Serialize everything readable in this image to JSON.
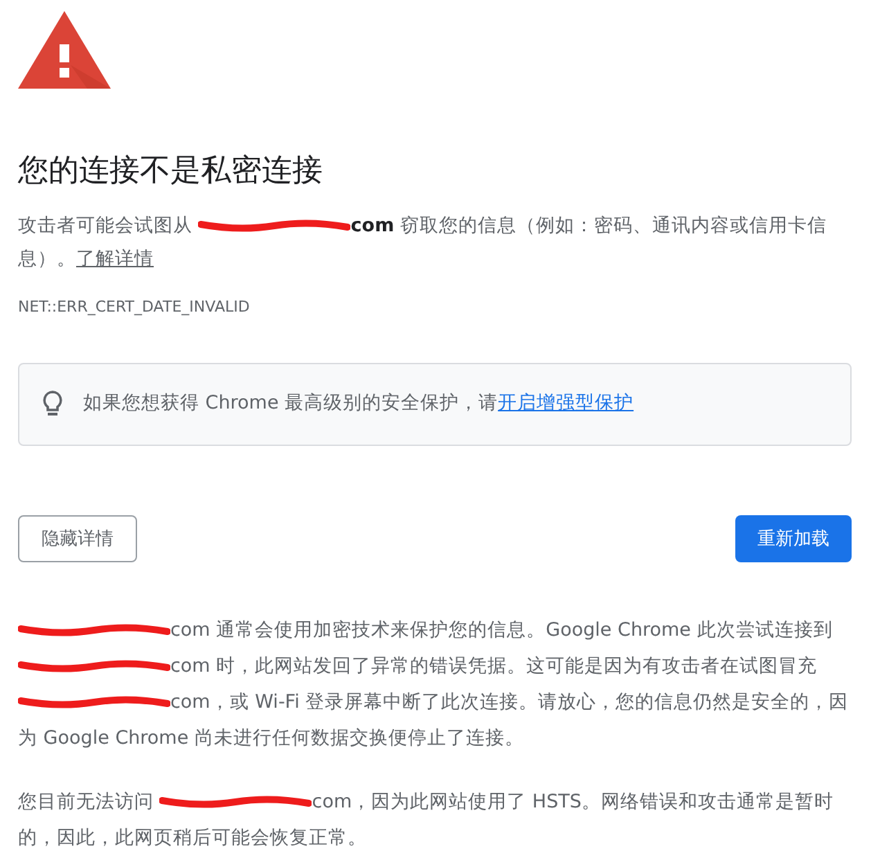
{
  "title": "您的连接不是私密连接",
  "intro": [
    {
      "kind": "text",
      "text": "攻击者可能会试图从 "
    },
    {
      "kind": "redacted",
      "text": "com"
    },
    {
      "kind": "text",
      "text": " 窃取您的信息（例如：密码、通讯内容或信用卡信息）。"
    },
    {
      "kind": "link",
      "text": "了解详情"
    }
  ],
  "error_code": "NET::ERR_CERT_DATE_INVALID",
  "notice": [
    {
      "kind": "text",
      "text": "如果您想获得 Chrome 最高级别的安全保护，请"
    },
    {
      "kind": "link",
      "text": "开启增强型保护"
    }
  ],
  "buttons": {
    "details": "隐藏详情",
    "reload": "重新加载"
  },
  "details": [
    [
      {
        "kind": "redacted",
        "text": "com"
      },
      {
        "kind": "text",
        "text": " 通常会使用加密技术来保护您的信息。Google Chrome 此次尝试连接到 "
      },
      {
        "kind": "redacted",
        "text": "com"
      },
      {
        "kind": "text",
        "text": " 时，此网站发回了异常的错误凭据。这可能是因为有攻击者在试图冒充 "
      },
      {
        "kind": "redacted",
        "text": "com"
      },
      {
        "kind": "text",
        "text": "，或 Wi-Fi 登录屏幕中断了此次连接。请放心，您的信息仍然是安全的，因为 Google Chrome 尚未进行任何数据交换便停止了连接。"
      }
    ],
    [
      {
        "kind": "text",
        "text": "您目前无法访问 "
      },
      {
        "kind": "redacted",
        "text": "com"
      },
      {
        "kind": "text",
        "text": "，因为此网站使用了 HSTS。网络错误和攻击通常是暂时的，因此，此网页稍后可能会恢复正常。"
      }
    ]
  ]
}
